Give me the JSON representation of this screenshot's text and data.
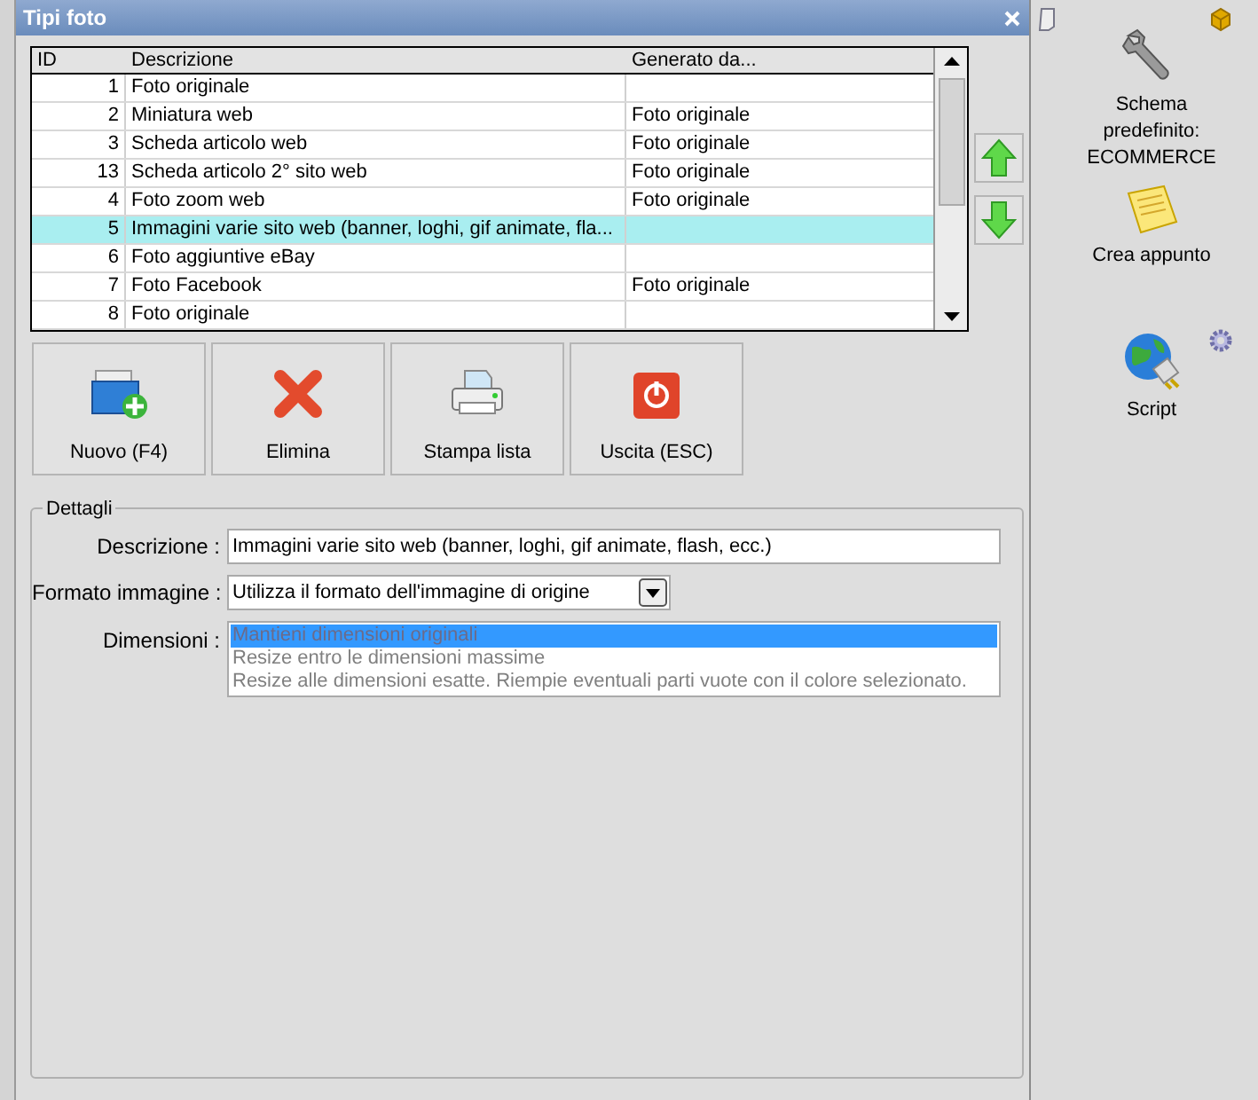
{
  "window": {
    "title": "Tipi foto"
  },
  "table": {
    "columns": [
      "ID",
      "Descrizione",
      "Generato da..."
    ],
    "rows": [
      {
        "id": "1",
        "descrizione": "Foto originale",
        "generato_da": "",
        "selected": false
      },
      {
        "id": "2",
        "descrizione": "Miniatura web",
        "generato_da": "Foto originale",
        "selected": false
      },
      {
        "id": "3",
        "descrizione": "Scheda articolo web",
        "generato_da": "Foto originale",
        "selected": false
      },
      {
        "id": "13",
        "descrizione": "Scheda articolo 2° sito web",
        "generato_da": "Foto originale",
        "selected": false
      },
      {
        "id": "4",
        "descrizione": "Foto zoom web",
        "generato_da": "Foto originale",
        "selected": false
      },
      {
        "id": "5",
        "descrizione": "Immagini varie sito web (banner, loghi, gif animate, fla...",
        "generato_da": "",
        "selected": true
      },
      {
        "id": "6",
        "descrizione": "Foto aggiuntive eBay",
        "generato_da": "",
        "selected": false
      },
      {
        "id": "7",
        "descrizione": "Foto Facebook",
        "generato_da": "Foto originale",
        "selected": false
      },
      {
        "id": "8",
        "descrizione": "Foto originale",
        "generato_da": "",
        "selected": false
      }
    ]
  },
  "buttons": [
    {
      "kind": "new",
      "label": "Nuovo (F4)"
    },
    {
      "kind": "delete",
      "label": "Elimina"
    },
    {
      "kind": "print",
      "label": "Stampa lista"
    },
    {
      "kind": "exit",
      "label": "Uscita (ESC)"
    }
  ],
  "details": {
    "title": "Dettagli",
    "descrizione": {
      "label": "Descrizione :",
      "value": "Immagini varie sito web (banner, loghi, gif animate, flash, ecc.)"
    },
    "formato": {
      "label": "Formato immagine :",
      "value": "Utilizza il formato dell'immagine di origine"
    },
    "dimensioni": {
      "label": "Dimensioni :",
      "options": [
        {
          "label": "Mantieni dimensioni originali",
          "selected": true
        },
        {
          "label": "Resize entro le dimensioni massime",
          "selected": false
        },
        {
          "label": "Resize alle dimensioni esatte. Riempie eventuali parti vuote con il colore selezionato.",
          "selected": false
        }
      ]
    }
  },
  "desktop": [
    {
      "kind": "wrench",
      "label": "Schema predefinito: ECOMMERCE"
    },
    {
      "kind": "note",
      "label": "Crea appunto"
    },
    {
      "kind": "globe",
      "label": "Script"
    }
  ]
}
